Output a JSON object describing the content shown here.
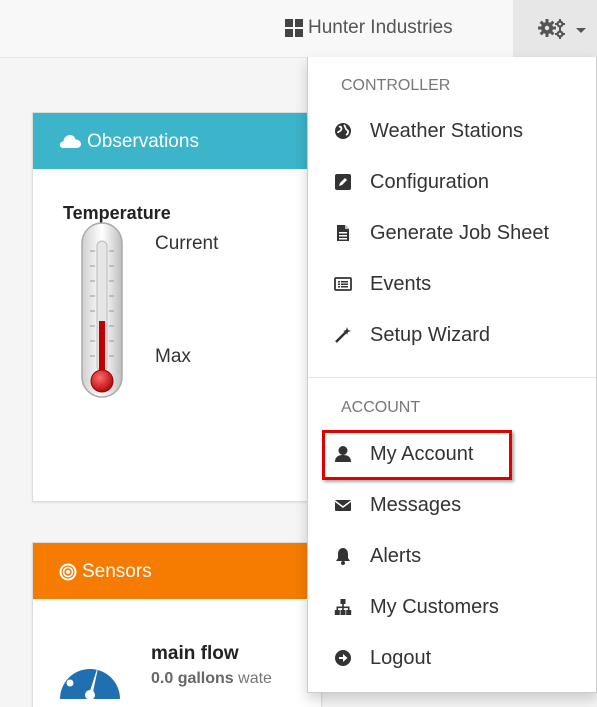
{
  "navbar": {
    "company_name": "Hunter Industries",
    "company_icon": "th-large-icon",
    "settings_icon": "gears-icon"
  },
  "observations": {
    "title": "Observations",
    "icon": "cloud-icon",
    "header_color": "#3cb4c9",
    "temperature_title": "Temperature",
    "current_label": "Current",
    "max_label": "Max"
  },
  "sensors": {
    "title": "Sensors",
    "icon": "bullseye-icon",
    "header_color": "#f57c00",
    "sensor_name": "main flow",
    "sensor_value": "0.0 gallons",
    "sensor_value_suffix": "wate"
  },
  "dropdown": {
    "controller_header": "CONTROLLER",
    "controller_items": [
      {
        "label": "Weather Stations",
        "icon": "globe-icon"
      },
      {
        "label": "Configuration",
        "icon": "edit-icon"
      },
      {
        "label": "Generate Job Sheet",
        "icon": "file-icon"
      },
      {
        "label": "Events",
        "icon": "list-alt-icon"
      },
      {
        "label": "Setup Wizard",
        "icon": "magic-wand-icon"
      }
    ],
    "account_header": "ACCOUNT",
    "account_items": [
      {
        "label": "My Account",
        "icon": "user-icon"
      },
      {
        "label": "Messages",
        "icon": "envelope-icon"
      },
      {
        "label": "Alerts",
        "icon": "bell-icon"
      },
      {
        "label": "My Customers",
        "icon": "sitemap-icon"
      },
      {
        "label": "Logout",
        "icon": "circle-arrow-right-icon"
      }
    ],
    "highlight_color": "#e00000"
  }
}
